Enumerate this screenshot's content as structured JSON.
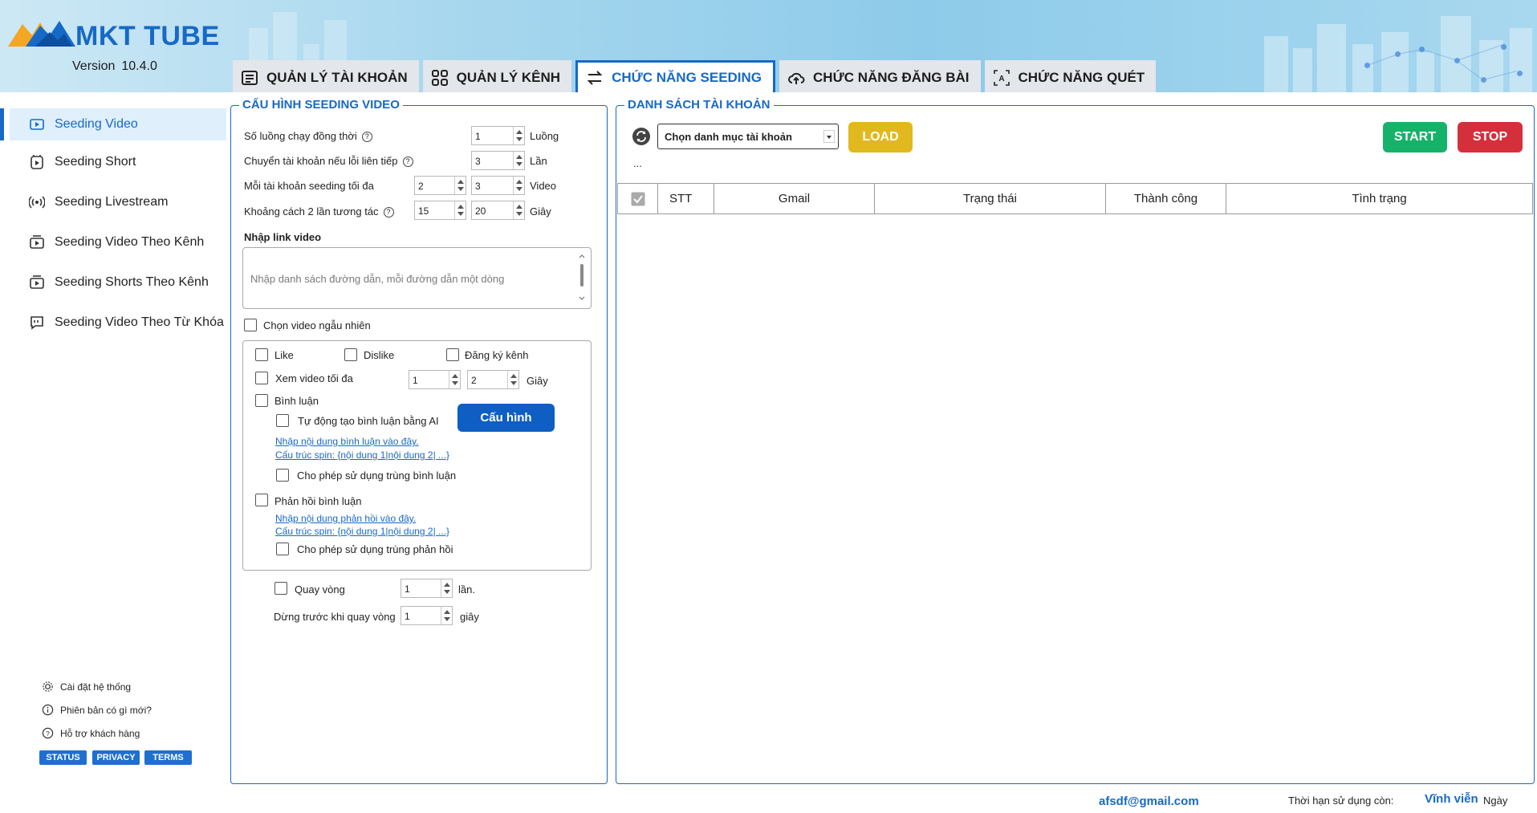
{
  "app": {
    "name": "MKT TUBE",
    "version_label": "Version",
    "version": "10.4.0"
  },
  "tabs": [
    {
      "label": "QUẢN LÝ TÀI KHOẢN",
      "icon": "account-list-icon",
      "active": false
    },
    {
      "label": "QUẢN LÝ KÊNH",
      "icon": "channels-icon",
      "active": false
    },
    {
      "label": "CHỨC NĂNG SEEDING",
      "icon": "swap-arrows-icon",
      "active": true
    },
    {
      "label": "CHỨC NĂNG ĐĂNG BÀI",
      "icon": "cloud-upload-icon",
      "active": false
    },
    {
      "label": "CHỨC NĂNG QUÉT",
      "icon": "scan-icon",
      "active": false
    }
  ],
  "sidebar": {
    "items": [
      {
        "label": "Seeding Video",
        "icon": "video-icon",
        "active": true
      },
      {
        "label": "Seeding Short",
        "icon": "shorts-icon",
        "active": false
      },
      {
        "label": "Seeding Livestream",
        "icon": "live-icon",
        "active": false
      },
      {
        "label": "Seeding Video Theo Kênh",
        "icon": "channel-video-icon",
        "active": false
      },
      {
        "label": "Seeding Shorts Theo Kênh",
        "icon": "channel-shorts-icon",
        "active": false
      },
      {
        "label": "Seeding Video Theo Từ Khóa",
        "icon": "keyword-icon",
        "active": false
      }
    ],
    "footer": {
      "settings": "Cài đặt hệ thống",
      "whats_new": "Phiên bản có gì mới?",
      "support": "Hỗ trợ khách hàng",
      "status": "STATUS",
      "privacy": "PRIVACY",
      "terms": "TERMS"
    }
  },
  "config": {
    "title": "CẤU HÌNH SEEDING VIDEO",
    "threads_label": "Số luồng chạy đồng thời",
    "threads_value": "1",
    "threads_unit": "Luồng",
    "switch_label": "Chuyển tài khoản nếu lỗi liên tiếp",
    "switch_value": "3",
    "switch_unit": "Lần",
    "max_label": "Mỗi tài khoản seeding tối đa",
    "max_from": "2",
    "max_to": "3",
    "max_unit": "Video",
    "interval_label": "Khoảng cách 2 lần tương tác",
    "interval_from": "15",
    "interval_to": "20",
    "interval_unit": "Giây",
    "link_label": "Nhập link video",
    "link_placeholder": "Nhập danh sách đường dẫn, mỗi đường dẫn một dòng",
    "random_label": "Chọn video ngẫu nhiên",
    "like": "Like",
    "dislike": "Dislike",
    "subscribe": "Đăng ký kênh",
    "watch_label": "Xem video tối đa",
    "watch_from": "1",
    "watch_to": "2",
    "watch_unit": "Giây",
    "comment_label": "Bình luận",
    "ai_comment_label": "Tự động tạo bình luận bằng AI",
    "config_button": "Cấu hình",
    "comment_link1": "Nhập nội dung bình luận vào đây.",
    "comment_link2": "Cấu trúc spin: {nội dung 1|nội dung 2| ...}",
    "allow_dup_comment": "Cho phép sử dụng trùng bình luận",
    "reply_label": "Phản hồi bình luận",
    "reply_link1": "Nhập nội dung phản hồi vào đây.",
    "reply_link2": "Cấu trúc spin: {nội dung 1|nội dung 2| ...}",
    "allow_dup_reply": "Cho phép sử dụng trùng phản hồi",
    "loop_label": "Quay vòng",
    "loop_value": "1",
    "loop_unit": "lần.",
    "stop_label": "Dừng trước khi quay vòng",
    "stop_value": "1",
    "stop_unit": "giây"
  },
  "accounts": {
    "title": "DANH SÁCH TÀI KHOẢN",
    "select_value": "Chọn danh mục tài khoản",
    "load_button": "LOAD",
    "start_button": "START",
    "stop_button": "STOP",
    "ellipsis": "...",
    "columns": [
      "STT",
      "Gmail",
      "Trạng thái",
      "Thành công",
      "Tình trạng"
    ],
    "rows": []
  },
  "footer": {
    "email": "afsdf@gmail.com",
    "expiry_label": "Thời hạn sử dụng còn:",
    "expiry_value": "Vĩnh viễn",
    "expiry_unit": "Ngày"
  },
  "colors": {
    "accent": "#1769c7",
    "load": "#e2b81f",
    "start": "#17b26a",
    "stop": "#d62f3c",
    "config_button": "#0e5ec4"
  }
}
